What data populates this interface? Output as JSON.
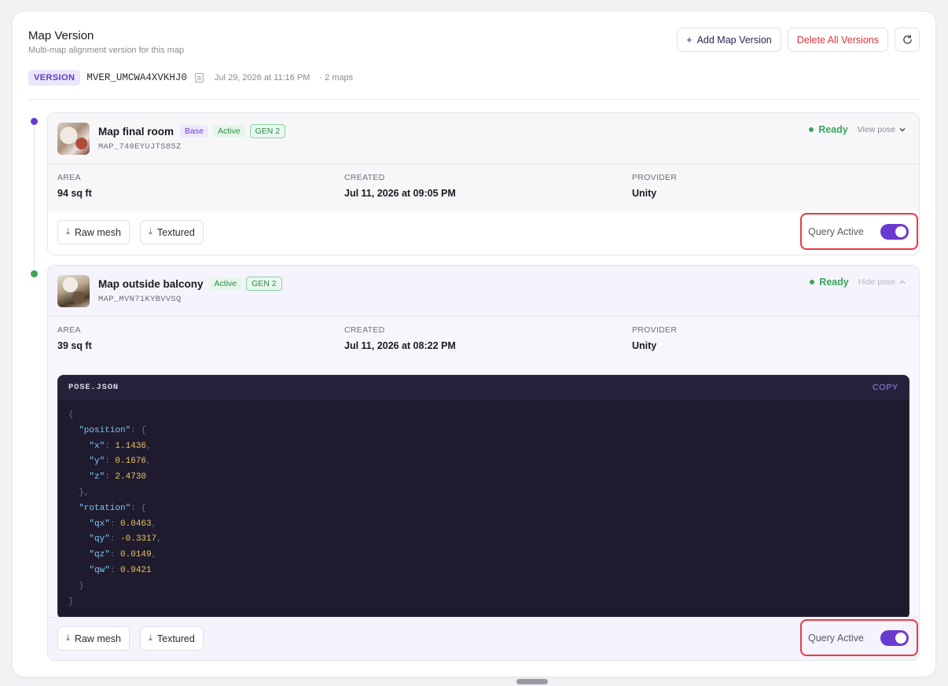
{
  "header": {
    "title": "Map Version",
    "subtitle": "Multi-map alignment version for this map",
    "add_label": "Add Map Version",
    "delete_label": "Delete All Versions"
  },
  "version": {
    "badge": "VERSION",
    "id": "MVER_UMCWA4XVKHJ0",
    "date": "Jul 29, 2026 at 11:16 PM",
    "count": "· 2 maps"
  },
  "maps": [
    {
      "name": "Map final room",
      "tags": [
        "Base",
        "Active",
        "GEN 2"
      ],
      "id": "MAP_740EYUJTS85Z",
      "status": "Ready",
      "pose_toggle": "View pose",
      "area_label": "AREA",
      "area": "94 sq ft",
      "created_label": "CREATED",
      "created": "Jul 11, 2026 at 09:05 PM",
      "provider_label": "PROVIDER",
      "provider": "Unity",
      "raw_label": "Raw mesh",
      "textured_label": "Textured",
      "query_label": "Query Active"
    },
    {
      "name": "Map outside balcony",
      "tags": [
        "Active",
        "GEN 2"
      ],
      "id": "MAP_MVN71KYBVVSQ",
      "status": "Ready",
      "pose_toggle": "Hide pose",
      "area_label": "AREA",
      "area": "39 sq ft",
      "created_label": "CREATED",
      "created": "Jul 11, 2026 at 08:22 PM",
      "provider_label": "PROVIDER",
      "provider": "Unity",
      "raw_label": "Raw mesh",
      "textured_label": "Textured",
      "query_label": "Query Active"
    }
  ],
  "pose": {
    "filename": "POSE.JSON",
    "copy_label": "COPY",
    "lines": [
      [
        [
          "p",
          "{"
        ]
      ],
      [
        [
          "p",
          "  "
        ],
        [
          "k",
          "\"position\""
        ],
        [
          "p",
          ": {"
        ]
      ],
      [
        [
          "p",
          "    "
        ],
        [
          "k",
          "\"x\""
        ],
        [
          "p",
          ": "
        ],
        [
          "n",
          "1.1436"
        ],
        [
          "p",
          ","
        ]
      ],
      [
        [
          "p",
          "    "
        ],
        [
          "k",
          "\"y\""
        ],
        [
          "p",
          ": "
        ],
        [
          "n",
          "0.1676"
        ],
        [
          "p",
          ","
        ]
      ],
      [
        [
          "p",
          "    "
        ],
        [
          "k",
          "\"z\""
        ],
        [
          "p",
          ": "
        ],
        [
          "n",
          "2.4730"
        ]
      ],
      [
        [
          "p",
          "  },"
        ]
      ],
      [
        [
          "p",
          "  "
        ],
        [
          "k",
          "\"rotation\""
        ],
        [
          "p",
          ": {"
        ]
      ],
      [
        [
          "p",
          "    "
        ],
        [
          "k",
          "\"qx\""
        ],
        [
          "p",
          ": "
        ],
        [
          "n",
          "0.0463"
        ],
        [
          "p",
          ","
        ]
      ],
      [
        [
          "p",
          "    "
        ],
        [
          "k",
          "\"qy\""
        ],
        [
          "p",
          ": "
        ],
        [
          "n",
          "-0.3317"
        ],
        [
          "p",
          ","
        ]
      ],
      [
        [
          "p",
          "    "
        ],
        [
          "k",
          "\"qz\""
        ],
        [
          "p",
          ": "
        ],
        [
          "n",
          "0.0149"
        ],
        [
          "p",
          ","
        ]
      ],
      [
        [
          "p",
          "    "
        ],
        [
          "k",
          "\"qw\""
        ],
        [
          "p",
          ": "
        ],
        [
          "n",
          "0.9421"
        ]
      ],
      [
        [
          "p",
          "  }"
        ]
      ],
      [
        [
          "p",
          "}"
        ]
      ]
    ]
  },
  "colors": {
    "accent": "#6a3bd0",
    "success": "#3aa55a",
    "danger": "#e0323a",
    "highlight": "#e83a42"
  }
}
